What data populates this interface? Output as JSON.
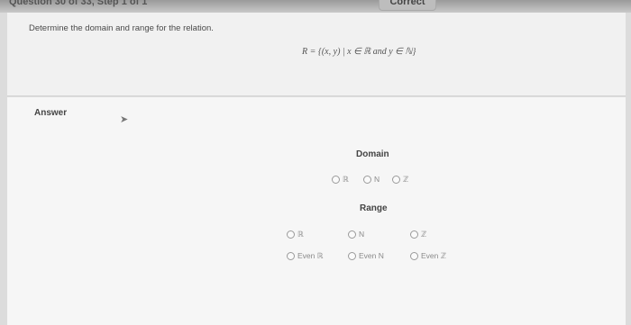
{
  "header": {
    "breadcrumb": "Question 30 of 33, Step 1 of 1",
    "status_tab": "Correct"
  },
  "question": {
    "prompt": "Determine the domain and range for the relation.",
    "relation": "R = {(x, y) | x ∈ ℝ and y ∈ ℕ}"
  },
  "answer": {
    "label": "Answer",
    "domain": {
      "title": "Domain",
      "options": [
        "ℝ",
        "N",
        "ℤ"
      ]
    },
    "range": {
      "title": "Range",
      "options": [
        "ℝ",
        "N",
        "ℤ",
        "Even ℝ",
        "Even N",
        "Even ℤ"
      ]
    }
  }
}
